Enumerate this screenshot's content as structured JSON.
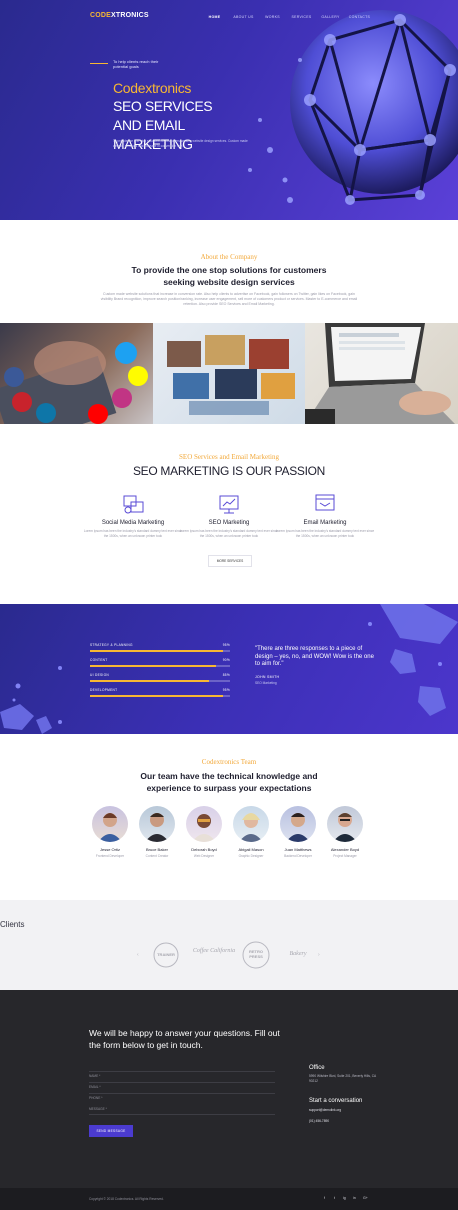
{
  "header": {
    "logo_part1": "CODE",
    "logo_part2": "XTRONICS",
    "nav": [
      "HOME",
      "ABOUT US",
      "WORKS",
      "SERVICES",
      "GALLERY",
      "CONTACTS"
    ]
  },
  "hero": {
    "tagline": "To help clients reach their potential goals",
    "brand": "Codextronics",
    "title": "SEO SERVICES AND EMAIL MARKETING",
    "description": "To provide the one stop solutions for customers seeking website design services. Custom made website solutions that increase in conversion rate."
  },
  "about": {
    "eyebrow": "About the Company",
    "heading": "To provide the one stop solutions for customers seeking website design services",
    "paragraph": "Custom made website solutions that increase in conversion rate. Also help clients to advertise on Facebook, gain followers on Twitter, gain likes on Facebook, gain visibility Brand recognition, improve search position/ranking, increase user engagement, sell more of customers product or services. Master to E-commerce and email retention. Also provide SEO Services and Email Marketing."
  },
  "services": {
    "eyebrow": "SEO Services and Email Marketing",
    "heading": "SEO MARKETING IS OUR PASSION",
    "items": [
      {
        "title": "Social Media Marketing",
        "text": "Lorem Ipsum has been the industry's standard dummy text ever since the 1500s, when an unknown printer took"
      },
      {
        "title": "SEO Marketing",
        "text": "Lorem Ipsum has been the industry's standard dummy text ever since the 1500s, when an unknown printer took"
      },
      {
        "title": "Email Marketing",
        "text": "Lorem Ipsum has been the industry's standard dummy text ever since the 1500s, when an unknown printer took"
      }
    ],
    "button": "MORE SERVICES"
  },
  "skills": {
    "items": [
      {
        "label": "STRATEGY & PLANNING",
        "percent_text": "95%",
        "value": 0.95
      },
      {
        "label": "CONTENT",
        "percent_text": "90%",
        "value": 0.9
      },
      {
        "label": "UI DESIGN",
        "percent_text": "85%",
        "value": 0.85
      },
      {
        "label": "DEVELOPMENT",
        "percent_text": "95%",
        "value": 0.95
      }
    ],
    "quote": "\"There are three responses to a piece of design – yes, no, and WOW! Wow is the one to aim for.\"",
    "quote_author": "JOHN SMITH",
    "quote_role": "SEO Marketing"
  },
  "team": {
    "eyebrow": "Codextronics Team",
    "heading": "Our team have the technical knowledge and experience to surpass your expectations",
    "members": [
      {
        "name": "Jesse Ortiz",
        "role": "Frontend Developer"
      },
      {
        "name": "Bruce Baker",
        "role": "Content Creator"
      },
      {
        "name": "Deborah Boyd",
        "role": "Web Designer"
      },
      {
        "name": "Abigail Mason",
        "role": "Graphic Designer"
      },
      {
        "name": "Juan Matthews",
        "role": "Backend Developer"
      },
      {
        "name": "Alexander Boyd",
        "role": "Project Manager"
      }
    ]
  },
  "clients": {
    "title": "Clients",
    "logos": [
      "TRAINER",
      "Coffee California",
      "RETRO PRESS",
      "Bakery"
    ]
  },
  "contact": {
    "heading": "We will be happy to answer your questions. Fill out the form below to get in touch.",
    "fields": [
      "NAME *",
      "EMAIL *",
      "PHONE *",
      "MESSAGE *"
    ],
    "button": "SEND MESSAGE",
    "office_title": "Office",
    "office_address": "5990 Wilshire Blvd, Suite 201, Beverly Hills, CA 90212",
    "conversation_title": "Start a conversation",
    "email": "support@demolink.org",
    "phone": "(01) 456-7890"
  },
  "footer": {
    "copyright": "Copyright © 2018 Codextronics. All Rights Reserved.",
    "social": [
      "f",
      "t",
      "ig",
      "in",
      "G+"
    ]
  },
  "colors": {
    "accent": "#f7b733",
    "brand_purple": "#3a2fb0",
    "dark": "#27272b"
  }
}
